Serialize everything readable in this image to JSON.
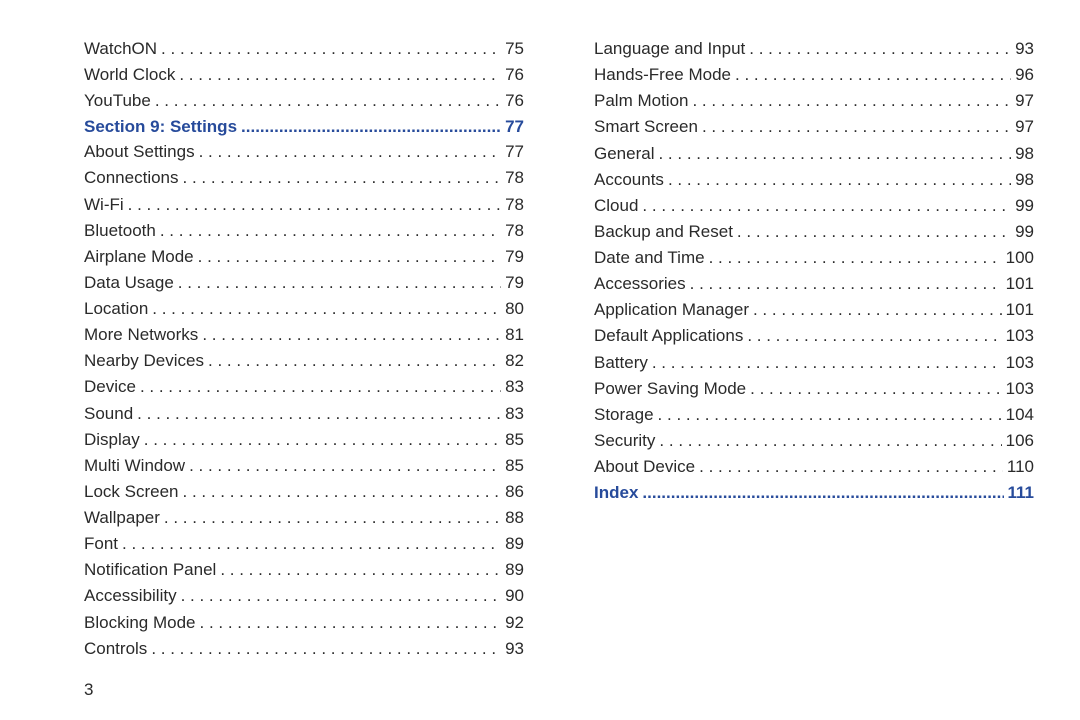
{
  "page_number": "3",
  "left": [
    {
      "label": "WatchON",
      "page": "75",
      "section": false
    },
    {
      "label": "World Clock",
      "page": "76",
      "section": false
    },
    {
      "label": "YouTube",
      "page": "76",
      "section": false
    },
    {
      "label": "Section 9:  Settings",
      "page": "77",
      "section": true
    },
    {
      "label": "About Settings",
      "page": "77",
      "section": false
    },
    {
      "label": "Connections",
      "page": "78",
      "section": false
    },
    {
      "label": "Wi-Fi",
      "page": "78",
      "section": false
    },
    {
      "label": "Bluetooth",
      "page": "78",
      "section": false
    },
    {
      "label": "Airplane Mode",
      "page": "79",
      "section": false
    },
    {
      "label": "Data Usage",
      "page": "79",
      "section": false
    },
    {
      "label": "Location",
      "page": "80",
      "section": false
    },
    {
      "label": "More Networks",
      "page": "81",
      "section": false
    },
    {
      "label": "Nearby Devices",
      "page": "82",
      "section": false
    },
    {
      "label": "Device",
      "page": "83",
      "section": false
    },
    {
      "label": "Sound",
      "page": "83",
      "section": false
    },
    {
      "label": "Display",
      "page": "85",
      "section": false
    },
    {
      "label": "Multi Window",
      "page": "85",
      "section": false
    },
    {
      "label": "Lock Screen",
      "page": "86",
      "section": false
    },
    {
      "label": "Wallpaper",
      "page": "88",
      "section": false
    },
    {
      "label": "Font",
      "page": "89",
      "section": false
    },
    {
      "label": "Notification Panel",
      "page": "89",
      "section": false
    },
    {
      "label": "Accessibility",
      "page": "90",
      "section": false
    },
    {
      "label": "Blocking Mode",
      "page": "92",
      "section": false
    },
    {
      "label": "Controls",
      "page": "93",
      "section": false
    }
  ],
  "right": [
    {
      "label": "Language and Input",
      "page": "93",
      "section": false
    },
    {
      "label": "Hands-Free Mode",
      "page": "96",
      "section": false
    },
    {
      "label": "Palm Motion",
      "page": "97",
      "section": false
    },
    {
      "label": "Smart Screen",
      "page": "97",
      "section": false
    },
    {
      "label": "General",
      "page": "98",
      "section": false
    },
    {
      "label": "Accounts",
      "page": "98",
      "section": false
    },
    {
      "label": "Cloud",
      "page": "99",
      "section": false
    },
    {
      "label": "Backup and Reset",
      "page": "99",
      "section": false
    },
    {
      "label": "Date and Time",
      "page": "100",
      "section": false
    },
    {
      "label": "Accessories",
      "page": "101",
      "section": false
    },
    {
      "label": "Application Manager",
      "page": "101",
      "section": false
    },
    {
      "label": "Default Applications",
      "page": "103",
      "section": false
    },
    {
      "label": "Battery",
      "page": "103",
      "section": false
    },
    {
      "label": "Power Saving Mode",
      "page": "103",
      "section": false
    },
    {
      "label": "Storage",
      "page": "104",
      "section": false
    },
    {
      "label": "Security",
      "page": "106",
      "section": false
    },
    {
      "label": "About Device",
      "page": "110",
      "section": false
    },
    {
      "label": "Index",
      "page": "111",
      "section": true
    }
  ]
}
